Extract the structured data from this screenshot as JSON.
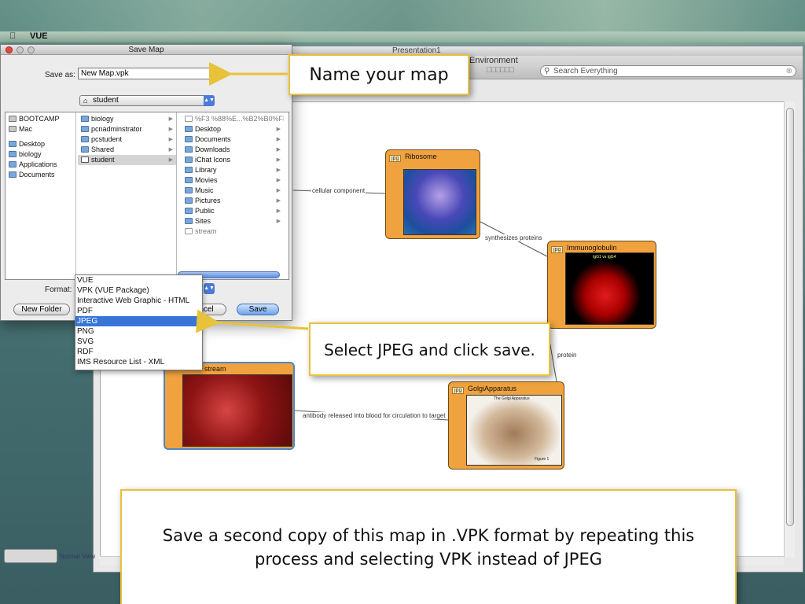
{
  "menubar": {
    "apple_icon": "apple-icon",
    "app_name": "VUE"
  },
  "vue_window": {
    "title": "Presentation1",
    "environment_label": "Environment",
    "search_placeholder": "Search Everything",
    "view_switch_label": "Normal View",
    "map": {
      "nodes": [
        {
          "label": "Ribosome",
          "badge": "jpg"
        },
        {
          "label": "Immunoglobulin",
          "badge": "jpg",
          "caption": "IgG1 vs IgG4"
        },
        {
          "label": "Blood Stream",
          "badge": "jpg"
        },
        {
          "label": "GolgiApparatus",
          "badge": "jpg",
          "caption": "The Golgi Apparatus",
          "figure": "Figure 1"
        }
      ],
      "links": [
        "cellular component",
        "synthesizes proteins",
        "protein",
        "antibody released into blood for circulation to target"
      ]
    }
  },
  "dialog": {
    "title": "Save Map",
    "save_as_label": "Save as:",
    "save_as_value": "New Map.vpk",
    "location": "student",
    "sidebar": [
      "BOOTCAMP",
      "Mac",
      "Desktop",
      "biology",
      "Applications",
      "Documents"
    ],
    "column1": [
      "biology",
      "pcnadminstrator",
      "pcstudent",
      "Shared",
      "student"
    ],
    "column2": [
      "%F3 %88%E...%B2%B0%FD",
      "Desktop",
      "Documents",
      "Downloads",
      "iChat Icons",
      "Library",
      "Movies",
      "Music",
      "Pictures",
      "Public",
      "Sites",
      "stream"
    ],
    "format_label": "Format:",
    "format_options": [
      "VUE",
      "VPK (VUE Package)",
      "Interactive Web Graphic - HTML",
      "PDF",
      "JPEG",
      "PNG",
      "SVG",
      "RDF",
      "IMS Resource List - XML"
    ],
    "format_selected": "JPEG",
    "new_folder_label": "New Folder",
    "cancel_label": "ncel",
    "save_label": "Save"
  },
  "callouts": {
    "name_map": "Name your map",
    "select_jpeg": "Select JPEG and click save.",
    "second_copy": "Save a second copy of this map in .VPK format by repeating this process and selecting VPK instead of JPEG"
  },
  "colors": {
    "callout_border": "#e8c23a",
    "arrow": "#e8c23a",
    "node_fill": "#f0a23e",
    "menu_highlight": "#3875d7"
  }
}
